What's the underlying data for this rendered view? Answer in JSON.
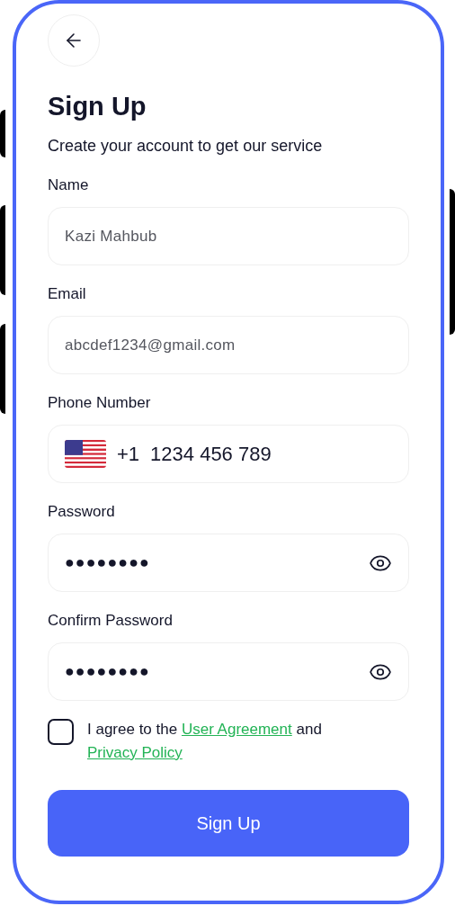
{
  "title": "Sign Up",
  "subtitle": "Create your account to get our service",
  "fields": [
    {
      "kind": "text",
      "label": "Name",
      "placeholder": "Kazi Mahbub"
    },
    {
      "kind": "text",
      "label": "Email",
      "placeholder": "abcdef1234@gmail.com"
    },
    {
      "kind": "phone",
      "label": "Phone Number",
      "code": "+1",
      "value": "1234 456 789"
    },
    {
      "kind": "password",
      "label": "Password",
      "value": "●●●●●●●●"
    },
    {
      "kind": "password",
      "label": "Confirm Password",
      "value": "●●●●●●●●"
    }
  ],
  "agreement": {
    "checked": false,
    "text": "I agree to the",
    "link1": "User Agreement",
    "joiner": "and",
    "link2": "Privacy Policy"
  },
  "submit": "Sign Up"
}
